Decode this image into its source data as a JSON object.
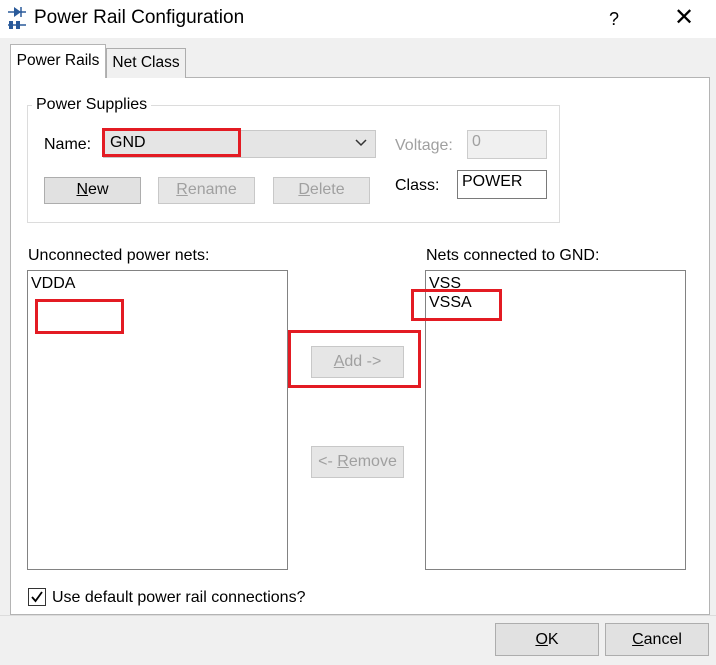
{
  "window": {
    "title": "Power Rail Configuration",
    "help_label": "?",
    "close_label": "✕"
  },
  "tabs": [
    {
      "label": "Power Rails",
      "active": true
    },
    {
      "label": "Net Class",
      "active": false
    }
  ],
  "power_supplies": {
    "group_title": "Power Supplies",
    "name_label": "Name:",
    "name_value": "GND",
    "voltage_label": "Voltage:",
    "voltage_value": "0",
    "class_label": "Class:",
    "class_value": "POWER",
    "buttons": {
      "new": {
        "mnemonic": "N",
        "rest": "ew"
      },
      "rename": {
        "mnemonic": "R",
        "rest": "ename"
      },
      "delete": {
        "mnemonic": "D",
        "rest": "elete"
      }
    }
  },
  "unconnected": {
    "label": "Unconnected power nets:",
    "items": [
      "VDDA"
    ]
  },
  "connected": {
    "label": "Nets connected to GND:",
    "items": [
      "VSS",
      "VSSA"
    ]
  },
  "transfer": {
    "add": {
      "mnemonic": "A",
      "rest": "dd ->"
    },
    "remove": {
      "prefix": "<- ",
      "mnemonic": "R",
      "rest": "emove"
    }
  },
  "default_connections": {
    "label": "Use default power rail connections?",
    "checked": true
  },
  "footer": {
    "ok": {
      "mnemonic": "O",
      "rest": "K"
    },
    "cancel": {
      "mnemonic": "C",
      "rest": "ancel"
    }
  },
  "colors": {
    "highlight": "#e31b23",
    "accent": "#0078d7"
  },
  "icons": {
    "app": "power-rail-icon",
    "combo": "chevron-down-icon",
    "check": "checkmark-icon"
  }
}
